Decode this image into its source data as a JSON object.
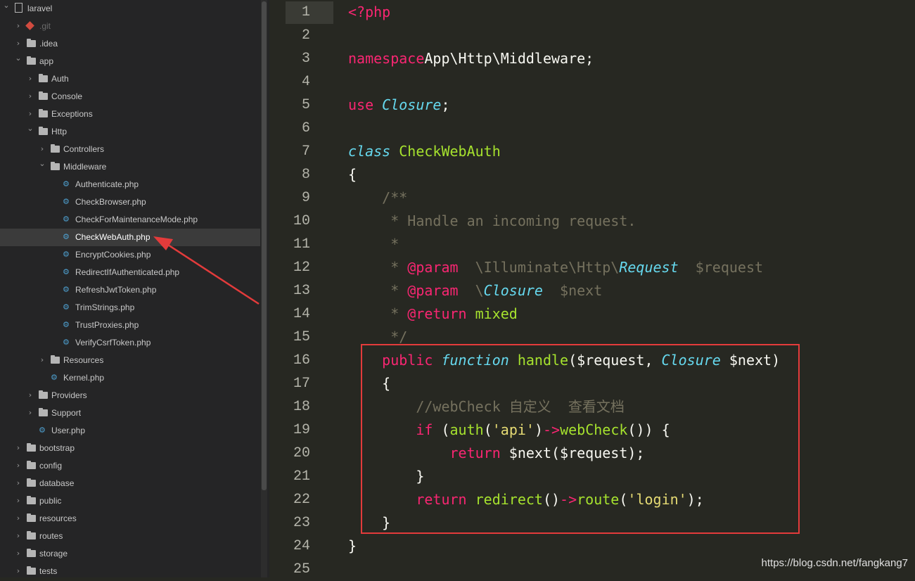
{
  "tree": [
    {
      "label": "laravel",
      "depth": 0,
      "arrow": "down",
      "icon": "repo"
    },
    {
      "label": ".git",
      "depth": 1,
      "arrow": "right",
      "icon": "git",
      "dim": true
    },
    {
      "label": ".idea",
      "depth": 1,
      "arrow": "right",
      "icon": "folder"
    },
    {
      "label": "app",
      "depth": 1,
      "arrow": "down",
      "icon": "folder"
    },
    {
      "label": "Auth",
      "depth": 2,
      "arrow": "right",
      "icon": "folder"
    },
    {
      "label": "Console",
      "depth": 2,
      "arrow": "right",
      "icon": "folder"
    },
    {
      "label": "Exceptions",
      "depth": 2,
      "arrow": "right",
      "icon": "folder"
    },
    {
      "label": "Http",
      "depth": 2,
      "arrow": "down",
      "icon": "folder"
    },
    {
      "label": "Controllers",
      "depth": 3,
      "arrow": "right",
      "icon": "folder"
    },
    {
      "label": "Middleware",
      "depth": 3,
      "arrow": "down",
      "icon": "folder"
    },
    {
      "label": "Authenticate.php",
      "depth": 4,
      "arrow": "",
      "icon": "php"
    },
    {
      "label": "CheckBrowser.php",
      "depth": 4,
      "arrow": "",
      "icon": "php"
    },
    {
      "label": "CheckForMaintenanceMode.php",
      "depth": 4,
      "arrow": "",
      "icon": "php"
    },
    {
      "label": "CheckWebAuth.php",
      "depth": 4,
      "arrow": "",
      "icon": "php",
      "selected": true
    },
    {
      "label": "EncryptCookies.php",
      "depth": 4,
      "arrow": "",
      "icon": "php"
    },
    {
      "label": "RedirectIfAuthenticated.php",
      "depth": 4,
      "arrow": "",
      "icon": "php"
    },
    {
      "label": "RefreshJwtToken.php",
      "depth": 4,
      "arrow": "",
      "icon": "php"
    },
    {
      "label": "TrimStrings.php",
      "depth": 4,
      "arrow": "",
      "icon": "php"
    },
    {
      "label": "TrustProxies.php",
      "depth": 4,
      "arrow": "",
      "icon": "php"
    },
    {
      "label": "VerifyCsrfToken.php",
      "depth": 4,
      "arrow": "",
      "icon": "php"
    },
    {
      "label": "Resources",
      "depth": 3,
      "arrow": "right",
      "icon": "folder"
    },
    {
      "label": "Kernel.php",
      "depth": 3,
      "arrow": "",
      "icon": "php"
    },
    {
      "label": "Providers",
      "depth": 2,
      "arrow": "right",
      "icon": "folder"
    },
    {
      "label": "Support",
      "depth": 2,
      "arrow": "right",
      "icon": "folder"
    },
    {
      "label": "User.php",
      "depth": 2,
      "arrow": "",
      "icon": "php"
    },
    {
      "label": "bootstrap",
      "depth": 1,
      "arrow": "right",
      "icon": "folder"
    },
    {
      "label": "config",
      "depth": 1,
      "arrow": "right",
      "icon": "folder"
    },
    {
      "label": "database",
      "depth": 1,
      "arrow": "right",
      "icon": "folder"
    },
    {
      "label": "public",
      "depth": 1,
      "arrow": "right",
      "icon": "folder"
    },
    {
      "label": "resources",
      "depth": 1,
      "arrow": "right",
      "icon": "folder"
    },
    {
      "label": "routes",
      "depth": 1,
      "arrow": "right",
      "icon": "folder"
    },
    {
      "label": "storage",
      "depth": 1,
      "arrow": "right",
      "icon": "folder"
    },
    {
      "label": "tests",
      "depth": 1,
      "arrow": "right",
      "icon": "folder"
    }
  ],
  "editor": {
    "line_numbers": [
      "1",
      "2",
      "3",
      "4",
      "5",
      "6",
      "7",
      "8",
      "9",
      "10",
      "11",
      "12",
      "13",
      "14",
      "15",
      "16",
      "17",
      "18",
      "19",
      "20",
      "21",
      "22",
      "23",
      "24",
      "25"
    ],
    "lines": [
      [
        [
          "tag",
          "<?php"
        ]
      ],
      [],
      [
        [
          "kw",
          "namespace"
        ],
        [
          "",
          "App\\Http\\Middleware;"
        ]
      ],
      [],
      [
        [
          "kw",
          "use"
        ],
        [
          "",
          " "
        ],
        [
          "it",
          "Closure"
        ],
        [
          "",
          ";"
        ]
      ],
      [],
      [
        [
          "it",
          "class"
        ],
        [
          "",
          " "
        ],
        [
          "cls",
          "CheckWebAuth"
        ]
      ],
      [
        [
          "",
          "{"
        ]
      ],
      [
        [
          "cm",
          "    /**"
        ]
      ],
      [
        [
          "cm",
          "     * Handle an incoming request."
        ]
      ],
      [
        [
          "cm",
          "     *"
        ]
      ],
      [
        [
          "cm",
          "     * "
        ],
        [
          "kw",
          "@param"
        ],
        [
          "cm",
          "  \\Illuminate\\Http\\"
        ],
        [
          "it",
          "Request"
        ],
        [
          "cm",
          "  $request"
        ]
      ],
      [
        [
          "cm",
          "     * "
        ],
        [
          "kw",
          "@param"
        ],
        [
          "cm",
          "  \\"
        ],
        [
          "it",
          "Closure"
        ],
        [
          "cm",
          "  $next"
        ]
      ],
      [
        [
          "cm",
          "     * "
        ],
        [
          "kw",
          "@return"
        ],
        [
          "",
          " "
        ],
        [
          "fn",
          "mixed"
        ]
      ],
      [
        [
          "cm",
          "     */"
        ]
      ],
      [
        [
          "",
          "    "
        ],
        [
          "kw",
          "public"
        ],
        [
          "",
          " "
        ],
        [
          "it",
          "function"
        ],
        [
          "",
          " "
        ],
        [
          "fn",
          "handle"
        ],
        [
          "",
          "($request, "
        ],
        [
          "it",
          "Closure"
        ],
        [
          "",
          " $next)"
        ]
      ],
      [
        [
          "",
          "    {"
        ]
      ],
      [
        [
          "cm",
          "        //webCheck 自定义  查看文档"
        ]
      ],
      [
        [
          "",
          "        "
        ],
        [
          "kw",
          "if"
        ],
        [
          "",
          " ("
        ],
        [
          "fn",
          "auth"
        ],
        [
          "",
          "("
        ],
        [
          "str",
          "'api'"
        ],
        [
          "",
          ")"
        ],
        [
          "kw",
          "->"
        ],
        [
          "fn",
          "webCheck"
        ],
        [
          "",
          "()) {"
        ]
      ],
      [
        [
          "",
          "            "
        ],
        [
          "kw",
          "return"
        ],
        [
          "",
          " $next($request);"
        ]
      ],
      [
        [
          "",
          "        }"
        ]
      ],
      [
        [
          "",
          "        "
        ],
        [
          "kw",
          "return"
        ],
        [
          "",
          " "
        ],
        [
          "fn",
          "redirect"
        ],
        [
          "",
          "()"
        ],
        [
          "kw",
          "->"
        ],
        [
          "fn",
          "route"
        ],
        [
          "",
          "("
        ],
        [
          "str",
          "'login'"
        ],
        [
          "",
          ");"
        ]
      ],
      [
        [
          "",
          "    }"
        ]
      ],
      [
        [
          "",
          "}"
        ]
      ],
      []
    ]
  },
  "collapse_toggle": "‹",
  "watermark": "https://blog.csdn.net/fangkang7",
  "colors": {
    "annotation": "#e33b3b",
    "background": "#272822",
    "sidebar": "#252526"
  }
}
